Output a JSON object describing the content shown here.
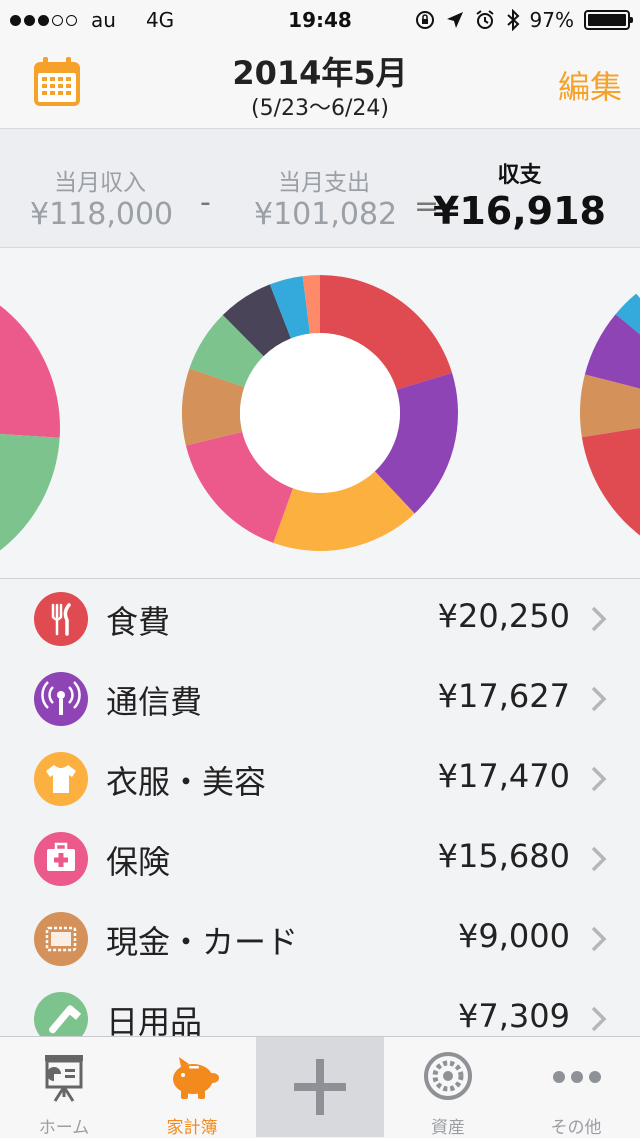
{
  "status_bar": {
    "carrier": "au",
    "network": "4G",
    "time": "19:48",
    "battery": "97%",
    "signal_bars_filled": 3,
    "signal_bars_total": 5
  },
  "nav": {
    "title": "2014年5月",
    "subtitle": "(5/23〜6/24)",
    "edit_label": "編集"
  },
  "summary": {
    "income_label": "当月収入",
    "income_value": "¥118,000",
    "minus": "-",
    "expense_label": "当月支出",
    "expense_value": "¥101,082",
    "equals": "=",
    "balance_label": "収支",
    "balance_value": "¥16,918"
  },
  "chart_data": {
    "type": "pie",
    "values": [
      20250,
      17627,
      17470,
      15680,
      9000,
      7309,
      6500,
      3900,
      2000
    ],
    "colors": [
      "#e04b52",
      "#8e44b5",
      "#fbb040",
      "#ec5a8c",
      "#d4925a",
      "#7dc38d",
      "#4a4459",
      "#34aadc",
      "#ff8a6a"
    ]
  },
  "categories": [
    {
      "name": "食費",
      "amount": "¥20,250",
      "color": "#e04b52",
      "icon": "fork-knife-icon"
    },
    {
      "name": "通信費",
      "amount": "¥17,627",
      "color": "#8e44b5",
      "icon": "antenna-icon"
    },
    {
      "name": "衣服・美容",
      "amount": "¥17,470",
      "color": "#fbb040",
      "icon": "tshirt-icon"
    },
    {
      "name": "保険",
      "amount": "¥15,680",
      "color": "#ec5a8c",
      "icon": "medkit-icon"
    },
    {
      "name": "現金・カード",
      "amount": "¥9,000",
      "color": "#d4925a",
      "icon": "wallet-icon"
    },
    {
      "name": "日用品",
      "amount": "¥7,309",
      "color": "#7dc38d",
      "icon": "toothbrush-icon"
    }
  ],
  "tabs": [
    {
      "label": "ホーム",
      "icon": "presentation-icon"
    },
    {
      "label": "家計簿",
      "icon": "piggy-bank-icon"
    },
    {
      "label": "",
      "icon": "plus-icon"
    },
    {
      "label": "資産",
      "icon": "gauge-icon"
    },
    {
      "label": "その他",
      "icon": "more-dots-icon"
    }
  ],
  "accent_color": "#f5a12a"
}
